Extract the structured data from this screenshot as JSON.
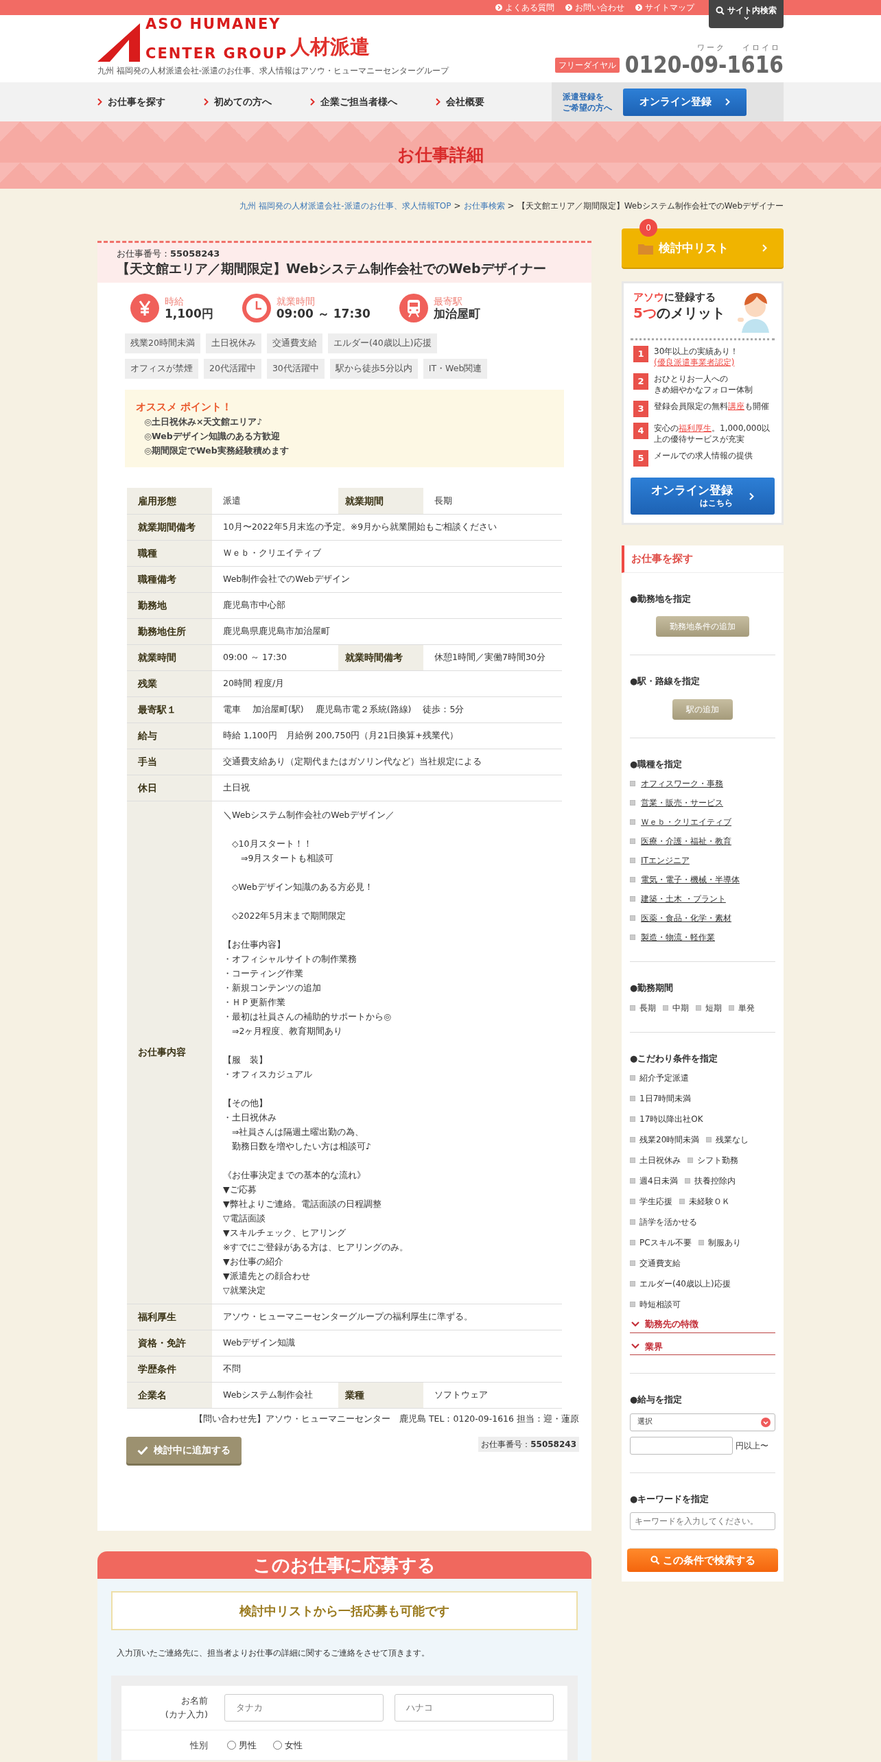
{
  "top_links": [
    {
      "label": "よくある質問"
    },
    {
      "label": "お問い合わせ"
    },
    {
      "label": "サイトマップ"
    }
  ],
  "site_search": {
    "label": "サイト内検索"
  },
  "logo": {
    "line1": "ASO HUMANEY",
    "line2": "CENTER GROUP",
    "suffix": "人材派遣",
    "tagline": "九州 福岡発の人材派遣会社-派遣のお仕事、求人情報はアソウ・ヒューマニーセンターグループ"
  },
  "phone": {
    "badge": "フリーダイヤル",
    "ruby": [
      "ワーク",
      "イロイロ"
    ],
    "number": "0120-09-1616"
  },
  "nav": [
    {
      "label": "お仕事を探す"
    },
    {
      "label": "初めての方へ"
    },
    {
      "label": "企業ご担当者様へ"
    },
    {
      "label": "会社概要"
    }
  ],
  "nav_register": {
    "caption_lines": [
      "派遣登録を",
      "ご希望の方へ"
    ],
    "button": "オンライン登録"
  },
  "page_title": "お仕事詳細",
  "breadcrumbs": {
    "separator": ">",
    "items": [
      {
        "label": "九州 福岡発の人材派遣会社-派遣のお仕事、求人情報TOP",
        "link": true
      },
      {
        "label": "お仕事検索",
        "link": true
      },
      {
        "label": "【天文館エリア／期間限定】Webシステム制作会社でのWebデザイナー",
        "link": false
      }
    ]
  },
  "job": {
    "number_label": "お仕事番号：",
    "number": "55058243",
    "title": "【天文館エリア／期間限定】Webシステム制作会社でのWebデザイナー",
    "highlights": [
      {
        "kind": "wage",
        "label": "時給",
        "value": "1,100円"
      },
      {
        "kind": "hours",
        "label": "就業時間",
        "value": "09:00 ～ 17:30"
      },
      {
        "kind": "station",
        "label": "最寄駅",
        "value": "加治屋町"
      }
    ],
    "tags": [
      "残業20時間未満",
      "土日祝休み",
      "交通費支給",
      "エルダー(40歳以上)応援",
      "オフィスが禁煙",
      "20代活躍中",
      "30代活躍中",
      "駅から徒歩5分以内",
      "IT・Web関連"
    ],
    "recommend": {
      "title": "オススメ ポイント！",
      "lines": [
        "◎土日祝休み×天文館エリア♪",
        "◎Webデザイン知識のある方歓迎",
        "◎期間限定でWeb実務経験積めます"
      ]
    },
    "table": [
      {
        "cells": [
          {
            "label": "雇用形態",
            "value": "派遣"
          },
          {
            "label": "就業期間",
            "value": "長期"
          }
        ]
      },
      {
        "cells": [
          {
            "label": "就業期間備考",
            "value": "10月〜2022年5月末迄の予定。※9月から就業開始もご相談ください"
          }
        ]
      },
      {
        "cells": [
          {
            "label": "職種",
            "value": "Ｗｅｂ・クリエイティブ"
          }
        ]
      },
      {
        "cells": [
          {
            "label": "職種備考",
            "value": "Web制作会社でのWebデザイン"
          }
        ]
      },
      {
        "cells": [
          {
            "label": "勤務地",
            "value": "鹿児島市中心部"
          }
        ]
      },
      {
        "cells": [
          {
            "label": "勤務地住所",
            "value": "鹿児島県鹿児島市加治屋町"
          }
        ]
      },
      {
        "cells": [
          {
            "label": "就業時間",
            "value": "09:00 ～ 17:30"
          },
          {
            "label": "就業時間備考",
            "value": "休憩1時間／実働7時間30分"
          }
        ]
      },
      {
        "cells": [
          {
            "label": "残業",
            "value": "20時間 程度/月"
          }
        ]
      },
      {
        "cells": [
          {
            "label": "最寄駅１",
            "value": "電車　 加治屋町(駅)　 鹿児島市電２系統(路線)　 徒歩：5分"
          }
        ]
      },
      {
        "cells": [
          {
            "label": "給与",
            "value": "時給 1,100円　月給例 200,750円（月21日換算+残業代）"
          }
        ]
      },
      {
        "cells": [
          {
            "label": "手当",
            "value": "交通費支給あり（定期代またはガソリン代など）当社規定による"
          }
        ]
      },
      {
        "cells": [
          {
            "label": "休日",
            "value": "土日祝"
          }
        ]
      },
      {
        "cells": [
          {
            "label": "お仕事内容",
            "paragraphs": [
              [
                "＼Webシステム制作会社のWebデザイン／"
              ],
              [
                "　◇10月スタート！！",
                "　　⇒9月スタートも相談可"
              ],
              [
                "　◇Webデザイン知識のある方必見！"
              ],
              [
                "　◇2022年5月末まで期間限定"
              ],
              [
                "【お仕事内容】",
                "・オフィシャルサイトの制作業務",
                "・コーティング作業",
                "・新規コンテンツの追加",
                "・ＨＰ更新作業",
                "・最初は社員さんの補助的サポートから◎",
                "　⇒2ヶ月程度、教育期間あり"
              ],
              [
                "【服　装】",
                "・オフィスカジュアル"
              ],
              [
                "【その他】",
                "・土日祝休み",
                "　⇒社員さんは隔週土曜出勤の為、",
                "　勤務日数を増やしたい方は相談可♪"
              ],
              [
                "《お仕事決定までの基本的な流れ》",
                "▼ご応募",
                "▼弊社よりご連絡。電話面談の日程調整",
                "▽電話面談",
                "▼スキルチェック、ヒアリング",
                "※すでにご登録がある方は、ヒアリングのみ。",
                "▼お仕事の紹介",
                "▼派遣先との顔合わせ",
                "▽就業決定"
              ]
            ]
          }
        ]
      },
      {
        "cells": [
          {
            "label": "福利厚生",
            "value": "アソウ・ヒューマニーセンターグループの福利厚生に準ずる。"
          }
        ]
      },
      {
        "cells": [
          {
            "label": "資格・免許",
            "value": "Webデザイン知識"
          }
        ]
      },
      {
        "cells": [
          {
            "label": "学歴条件",
            "value": "不問"
          }
        ]
      },
      {
        "cells": [
          {
            "label": "企業名",
            "value": "Webシステム制作会社"
          },
          {
            "label": "業種",
            "value": "ソフトウェア"
          }
        ]
      }
    ],
    "contact": "【問い合わせ先】アソウ・ヒューマニーセンター　鹿児島 TEL：0120-09-1616 担当：迎・蓮原",
    "add_button": "検討中に追加する",
    "footer_number_label": "お仕事番号：",
    "footer_number": "55058243"
  },
  "apply": {
    "title": "このお仕事に応募する",
    "notice": "検討中リストから一括応募も可能です",
    "intro": "入力頂いたご連絡先に、担当者よりお仕事の詳細に関するご連絡をさせて頂きます。",
    "name_label_lines": [
      "お名前",
      "(カナ入力)"
    ],
    "name_placeholders": [
      "タナカ",
      "ハナコ"
    ],
    "gender_label": "性別",
    "genders": [
      {
        "label": "男性",
        "selected": false
      },
      {
        "label": "女性",
        "selected": false
      }
    ]
  },
  "review_list": {
    "count": "0",
    "label": "検討中リスト"
  },
  "merits": {
    "title_accent": "アソウ",
    "title_rest": "に登録する",
    "count_accent": "5つ",
    "count_rest": "のメリット",
    "items": [
      {
        "num": "1",
        "lines": [
          [
            {
              "text": "30年以上の実績あり！"
            }
          ],
          [
            {
              "text": "(優良派遣事業者認定)",
              "link": true
            }
          ]
        ]
      },
      {
        "num": "2",
        "lines": [
          [
            {
              "text": "おひとりお一人への"
            }
          ],
          [
            {
              "text": "きめ細やかなフォロー体制"
            }
          ]
        ]
      },
      {
        "num": "3",
        "lines": [
          [
            {
              "text": "登録会員限定の無料"
            },
            {
              "text": "講座",
              "link": true
            },
            {
              "text": "も開催"
            }
          ]
        ]
      },
      {
        "num": "4",
        "lines": [
          [
            {
              "text": "安心の"
            },
            {
              "text": "福利厚生",
              "link": true
            },
            {
              "text": "。1,000,000以上の優待サービスが充実"
            }
          ]
        ]
      },
      {
        "num": "5",
        "lines": [
          [
            {
              "text": "メールでの求人情報の提供"
            }
          ]
        ]
      }
    ],
    "button": "オンライン登録",
    "button_sub": "はこちら"
  },
  "search": {
    "title": "お仕事を探す",
    "sections": [
      {
        "kind": "button",
        "heading": "●勤務地を指定",
        "button": "勤務地条件の追加"
      },
      {
        "kind": "button",
        "heading": "●駅・路線を指定",
        "button": "駅の追加"
      },
      {
        "kind": "links",
        "heading": "●職種を指定",
        "items": [
          "オフィスワーク・事務",
          "営業・販売・サービス",
          "Ｗｅｂ・クリエイティブ",
          "医療・介護・福祉・教育",
          "ITエンジニア",
          "電気・電子・機械・半導体",
          "建築・土木 ・プラント",
          "医薬・食品・化学・素材",
          "製造・物流・軽作業"
        ]
      },
      {
        "kind": "checks",
        "heading": "●勤務期間",
        "rows": [
          [
            {
              "label": "長期",
              "checked": false
            },
            {
              "label": "中期",
              "checked": false
            },
            {
              "label": "短期",
              "checked": false
            },
            {
              "label": "単発",
              "checked": false
            }
          ]
        ]
      },
      {
        "kind": "checks",
        "heading": "●こだわり条件を指定",
        "rows": [
          [
            {
              "label": "紹介予定派遣",
              "checked": false
            }
          ],
          [
            {
              "label": "1日7時間未満",
              "checked": false
            }
          ],
          [
            {
              "label": "17時以降出社OK",
              "checked": false
            }
          ],
          [
            {
              "label": "残業20時間未満",
              "checked": false
            },
            {
              "label": "残業なし",
              "checked": false
            }
          ],
          [
            {
              "label": "土日祝休み",
              "checked": false
            },
            {
              "label": "シフト勤務",
              "checked": false
            }
          ],
          [
            {
              "label": "週4日未満",
              "checked": false
            },
            {
              "label": "扶養控除内",
              "checked": false
            }
          ],
          [
            {
              "label": "学生応援",
              "checked": false
            },
            {
              "label": "未経験ＯＫ",
              "checked": false
            }
          ],
          [
            {
              "label": "語学を活かせる",
              "checked": false
            }
          ],
          [
            {
              "label": "PCスキル不要",
              "checked": false
            },
            {
              "label": "制服あり",
              "checked": false
            }
          ],
          [
            {
              "label": "交通費支給",
              "checked": false
            }
          ],
          [
            {
              "label": "エルダー(40歳以上)応援",
              "checked": false
            }
          ],
          [
            {
              "label": "時短相談可",
              "checked": false
            }
          ]
        ],
        "toggles": [
          "勤務先の特徴",
          "業界"
        ]
      },
      {
        "kind": "salary",
        "heading": "●給与を指定",
        "select": "選択",
        "suffix": "円以上〜"
      },
      {
        "kind": "keyword",
        "heading": "●キーワードを指定",
        "placeholder": "キーワードを入力してください。"
      }
    ],
    "button": "この条件で検索する"
  }
}
